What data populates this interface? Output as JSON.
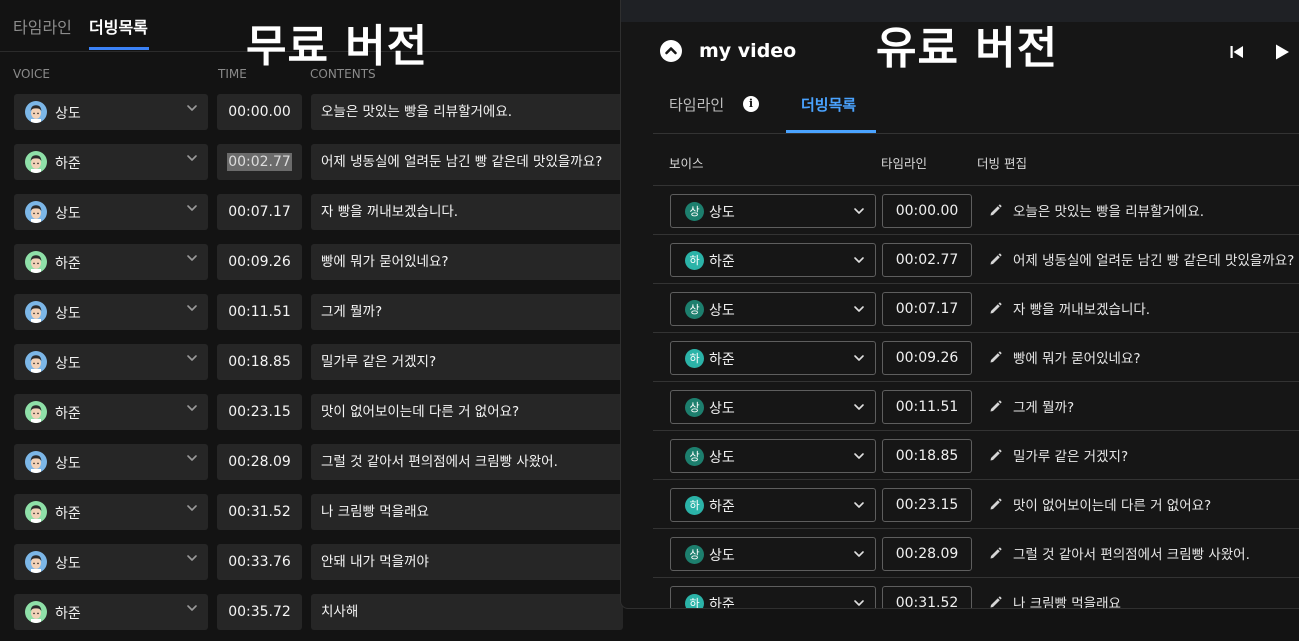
{
  "free": {
    "banner": "무료 버전",
    "tabs": [
      {
        "label": "타임라인"
      },
      {
        "label": "더빙목록"
      }
    ],
    "columns": {
      "voice": "VOICE",
      "time": "TIME",
      "contents": "CONTENTS"
    },
    "rows": [
      {
        "voice": "상도",
        "avatar": "sangdo",
        "time": "00:00.00",
        "content": "오늘은 맛있는 빵을 리뷰할거에요."
      },
      {
        "voice": "하준",
        "avatar": "hajun",
        "time": "00:02.77",
        "highlight": true,
        "content": "어제 냉동실에 얼려둔 남긴 빵 같은데 맛있을까요?"
      },
      {
        "voice": "상도",
        "avatar": "sangdo",
        "time": "00:07.17",
        "content": "자 빵을 꺼내보겠습니다."
      },
      {
        "voice": "하준",
        "avatar": "hajun",
        "time": "00:09.26",
        "content": "빵에 뭐가 묻어있네요?"
      },
      {
        "voice": "상도",
        "avatar": "sangdo",
        "time": "00:11.51",
        "content": "그게 뭘까?"
      },
      {
        "voice": "상도",
        "avatar": "sangdo",
        "time": "00:18.85",
        "content": " 밀가루 같은 거겠지?"
      },
      {
        "voice": "하준",
        "avatar": "hajun",
        "time": "00:23.15",
        "content": "맛이 없어보이는데 다른 거 없어요?"
      },
      {
        "voice": "상도",
        "avatar": "sangdo",
        "time": "00:28.09",
        "content": "그럴 것 같아서 편의점에서 크림빵 사왔어."
      },
      {
        "voice": "하준",
        "avatar": "hajun",
        "time": "00:31.52",
        "content": "나 크림빵 먹을래요"
      },
      {
        "voice": "상도",
        "avatar": "sangdo",
        "time": "00:33.76",
        "content": "안돼 내가 먹을꺼야"
      },
      {
        "voice": "하준",
        "avatar": "hajun",
        "time": "00:35.72",
        "content": "치사해"
      }
    ]
  },
  "paid": {
    "banner": "유료 버전",
    "title": "my video",
    "tabs": [
      {
        "label": "타임라인"
      },
      {
        "label": "더빙목록"
      }
    ],
    "info_icon": "i",
    "columns": {
      "voice": "보이스",
      "time": "타임라인",
      "edit": "더빙 편집"
    },
    "rows": [
      {
        "badge": "상",
        "voice": "상도",
        "time": "00:00.00",
        "content": "오늘은 맛있는 빵을 리뷰할거에요."
      },
      {
        "badge": "하",
        "voice": "하준",
        "time": "00:02.77",
        "content": "어제 냉동실에 얼려둔 남긴 빵 같은데 맛있을까요?"
      },
      {
        "badge": "상",
        "voice": "상도",
        "time": "00:07.17",
        "content": "자 빵을 꺼내보겠습니다."
      },
      {
        "badge": "하",
        "voice": "하준",
        "time": "00:09.26",
        "content": "빵에 뭐가 묻어있네요?"
      },
      {
        "badge": "상",
        "voice": "상도",
        "time": "00:11.51",
        "content": "그게 뭘까?"
      },
      {
        "badge": "상",
        "voice": "상도",
        "time": "00:18.85",
        "content": "밀가루 같은 거겠지?"
      },
      {
        "badge": "하",
        "voice": "하준",
        "time": "00:23.15",
        "content": "맛이 없어보이는데 다른 거 없어요?"
      },
      {
        "badge": "상",
        "voice": "상도",
        "time": "00:28.09",
        "content": "그럴 것 같아서 편의점에서 크림빵 사왔어."
      },
      {
        "badge": "하",
        "voice": "하준",
        "time": "00:31.52",
        "content": "나 크림빵 먹을래요"
      }
    ]
  },
  "colors": {
    "accent": "#3b82f6",
    "paid_accent": "#4aa3ff",
    "badge_sangdo": "#1d7f6e",
    "badge_hajun": "#2bb3a8"
  },
  "icons": {
    "collapse": "chevron-up-icon",
    "prev": "skip-previous-icon",
    "play": "play-icon",
    "edit": "pencil-icon",
    "dropdown": "chevron-down-icon"
  }
}
